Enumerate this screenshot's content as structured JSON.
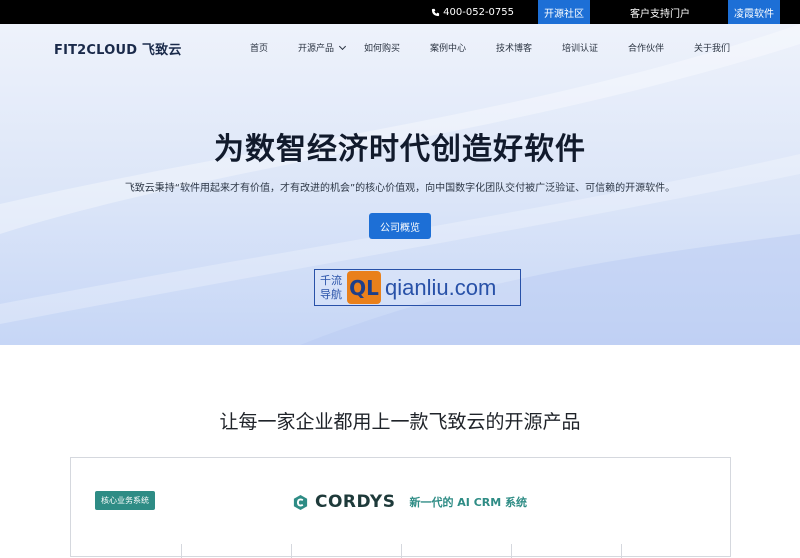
{
  "topbar": {
    "phone": "400-052-0755",
    "links": [
      "开源社区",
      "客户支持门户",
      "凌霞软件"
    ]
  },
  "nav": {
    "logo_text": "FIT2CLOUD 飞致云",
    "items": [
      "首页",
      "开源产品",
      "如何购买",
      "案例中心",
      "技术博客",
      "培训认证",
      "合作伙伴",
      "关于我们"
    ]
  },
  "hero": {
    "headline": "为数智经济时代创造好软件",
    "subline": "飞致云秉持“软件用起来才有价值，才有改进的机会”的核心价值观，向中国数字化团队交付被广泛验证、可信赖的开源软件。",
    "cta_label": "公司概览"
  },
  "watermark": {
    "cn_line1": "千流",
    "cn_line2": "导航",
    "ql": "QL",
    "en": "qianliu.com"
  },
  "products": {
    "section_title": "让每一家企业都用上一款飞致云的开源产品",
    "badge": "核心业务系统",
    "product_name": "CORDYS",
    "product_tagline": "新一代的 AI CRM 系统"
  },
  "colors": {
    "accent": "#1d6fd6",
    "teal": "#2e8c85",
    "topbar_bg": "#000000"
  }
}
